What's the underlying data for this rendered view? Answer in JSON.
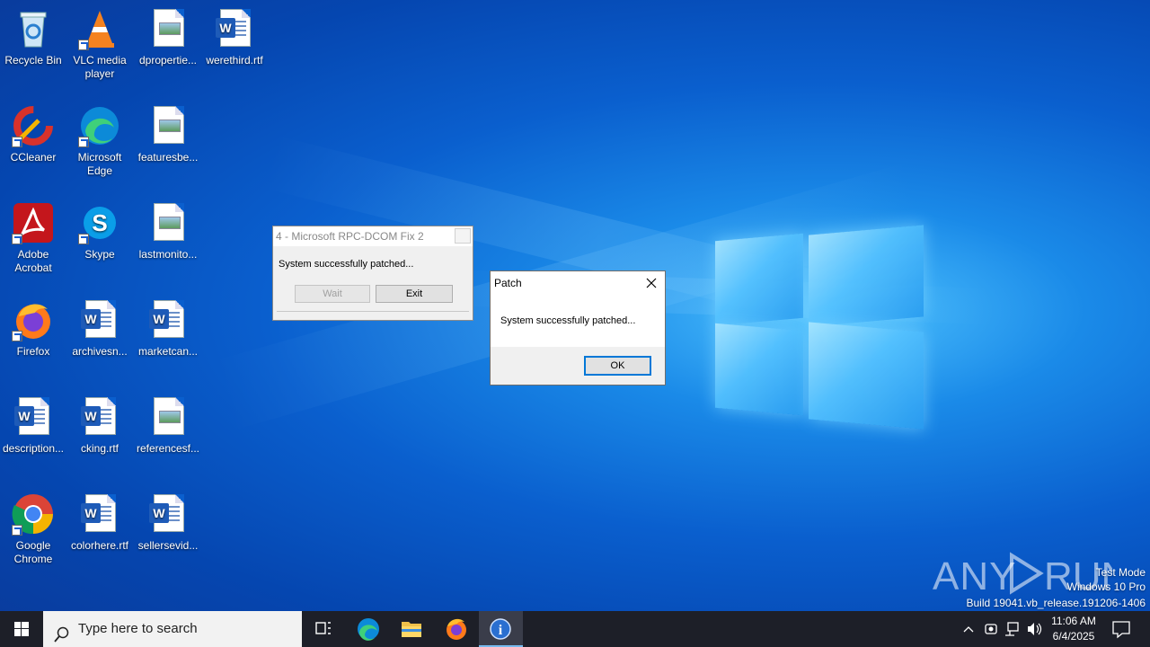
{
  "desktop": {
    "icons": [
      {
        "label": "Recycle Bin"
      },
      {
        "label": "VLC media player"
      },
      {
        "label": "dpropertie..."
      },
      {
        "label": "werethird.rtf"
      },
      {
        "label": "CCleaner"
      },
      {
        "label": "Microsoft Edge"
      },
      {
        "label": "featuresbe..."
      },
      {
        "label": "Adobe Acrobat"
      },
      {
        "label": "Skype"
      },
      {
        "label": "lastmonito..."
      },
      {
        "label": "Firefox"
      },
      {
        "label": "archivesn..."
      },
      {
        "label": "marketcan..."
      },
      {
        "label": "description..."
      },
      {
        "label": "cking.rtf"
      },
      {
        "label": "referencesf..."
      },
      {
        "label": "Google Chrome"
      },
      {
        "label": "colorhere.rtf"
      },
      {
        "label": "sellersevid..."
      }
    ]
  },
  "fix_dialog": {
    "title": "4 - Microsoft RPC-DCOM Fix 2",
    "message": "System successfully patched...",
    "wait_label": "Wait",
    "exit_label": "Exit"
  },
  "patch_dialog": {
    "title": "Patch",
    "message": "System successfully patched...",
    "ok_label": "OK"
  },
  "taskbar": {
    "search_placeholder": "Type here to search",
    "time": "11:06 AM",
    "date": "6/4/2025"
  },
  "watermark": {
    "brand": "ANY RUN",
    "line1": "Test Mode",
    "line2": "Windows 10 Pro",
    "line3": "Build 19041.vb_release.191206-1406"
  },
  "colors": {
    "accent": "#0078d7",
    "taskbar": "#1d1f28",
    "desktop_blue": "#0a5fce"
  }
}
